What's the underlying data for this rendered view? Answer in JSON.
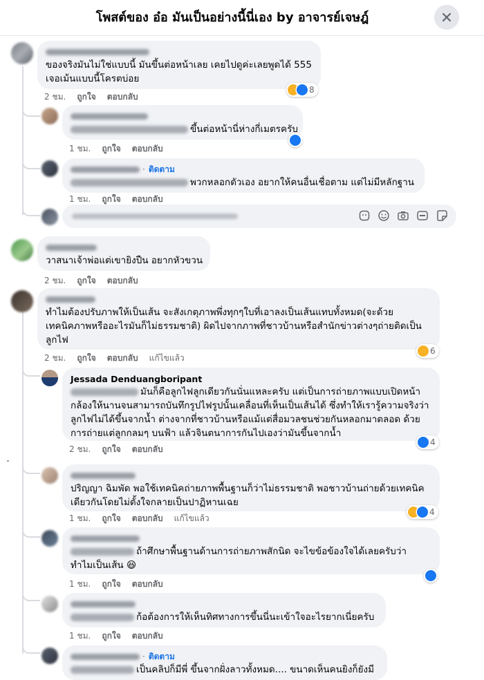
{
  "header": {
    "title": "โพสต์ของ อ๋อ มันเป็นอย่างนี้นี่เอง by อาจารย์เจษฎ์"
  },
  "colors": {
    "link": "#1b74e4",
    "bubble": "#f0f2f5",
    "meta": "#65676b",
    "like": "#1877f2",
    "haha": "#f7b125"
  },
  "labels": {
    "like": "ถูกใจ",
    "reply": "ตอบกลับ",
    "edited": "แก้ไขแล้ว",
    "follow": "ติดตาม"
  },
  "comments": [
    {
      "lines": [
        "ของจริงมันไม่ใช่แบบนี้ มันขึ้นต่อหน้าเลย เคยไปดูค่ะเลยพูดได้ 555",
        "เจอเม้นแบบนี้โครตบ่อย"
      ],
      "time": "2 ชม.",
      "reactions": "8",
      "reaction_icons": [
        "haha-icon",
        "like-icon"
      ]
    },
    {
      "line": "ขึ้นต่อหน้านี่ห่างกี่เมตรครับ",
      "time": "1 ชม.",
      "reaction_icons": [
        "like-icon"
      ]
    },
    {
      "line": "พวกหลอกตัวเอง อยากให้คนอื่นเชื่อตาม แต่ไม่มีหลักฐาน",
      "time": "1 ชม."
    },
    {
      "lines": [
        "วาสนาเจ้าพ่อแต่เขายิงปืน อยากหัวขวน"
      ],
      "time": "2 ชม."
    },
    {
      "lines": [
        "ทำไมต้องปรับภาพให้เป็นเส้น จะสังเกตุภาพพึ่งทุกๆใบที่เอาลงเป็นเส้นแทบทั้งหมด(จะด้วย",
        "เทคนิคภาพหรืออะไรมันก็ไม่ธรรมชาติ) ผิดไปจากภาพที่ชาวบ้านหรือสำนักข่าวต่างๆถ่ายติดเป็น",
        "ลูกไฟ"
      ],
      "time": "2 ชม.",
      "reactions": "6",
      "reaction_icons": [
        "haha-icon"
      ]
    },
    {
      "name": "Jessada Denduangboripant",
      "lines": [
        "มันก็คือลูกไฟลูกเดียวกันนั่นแหละครับ แต่เป็นการถ่ายภาพแบบเปิดหน้า",
        "กล้องให้นานจนสามารถบันทึกรูปไฟรูปนั้นเคลื่อนที่เห็นเป็นเส้นได้ ซึ่งทำให้เรารู้ความจริงว่า",
        "ลูกไฟไม่ได้ขึ้นจากน้ำ ต่างจากที่ชาวบ้านหรือแม้แต่สื่อมวลชนช่วยกันหลอกมาตลอด ด้วย",
        "การถ่ายแต่ลูกกลมๆ บนฟ้า แล้วจินตนาการกันไปเองว่ามันขึ้นจากน้ำ"
      ],
      "time": "2 ชม.",
      "reactions": "4",
      "reaction_icons": [
        "like-icon"
      ]
    },
    {
      "lines": [
        "ปริญญา ฉิมพัด พอใช้เทคนิคถ่ายภาพพื้นฐานก็ว่าไม่ธรรมชาติ พอชาวบ้านถ่ายด้วยเทคนิค",
        "เดียวกันโดยไม่ตั้งใจกลายเป็นปาฏิหานเฉย"
      ],
      "time": "1 ชม.",
      "reactions": "4",
      "reaction_icons": [
        "haha-icon",
        "like-icon"
      ]
    },
    {
      "lines": [
        "ถ้าศึกษาพื้นฐานด้านการถ่ายภาพสักนิด จะไขข้อข้องใจได้เลยครับว่า",
        "ทำไมเป็นเส้น 😆"
      ],
      "time": "1 ชม.",
      "reaction_icons": [
        "like-icon"
      ]
    },
    {
      "line": "ก้อต้องการให้เห็นทิศทางการขึ้นนี่นะเข้าใจอะไรยากเนี่ยครับ",
      "time": "1 ชม."
    },
    {
      "line": "เป็นคลิปก็มีพี่ ขึ้นจากฝั่งลาวทั้งหมด.... ขนาดเห็นคนยิงก็ยังมี"
    }
  ]
}
